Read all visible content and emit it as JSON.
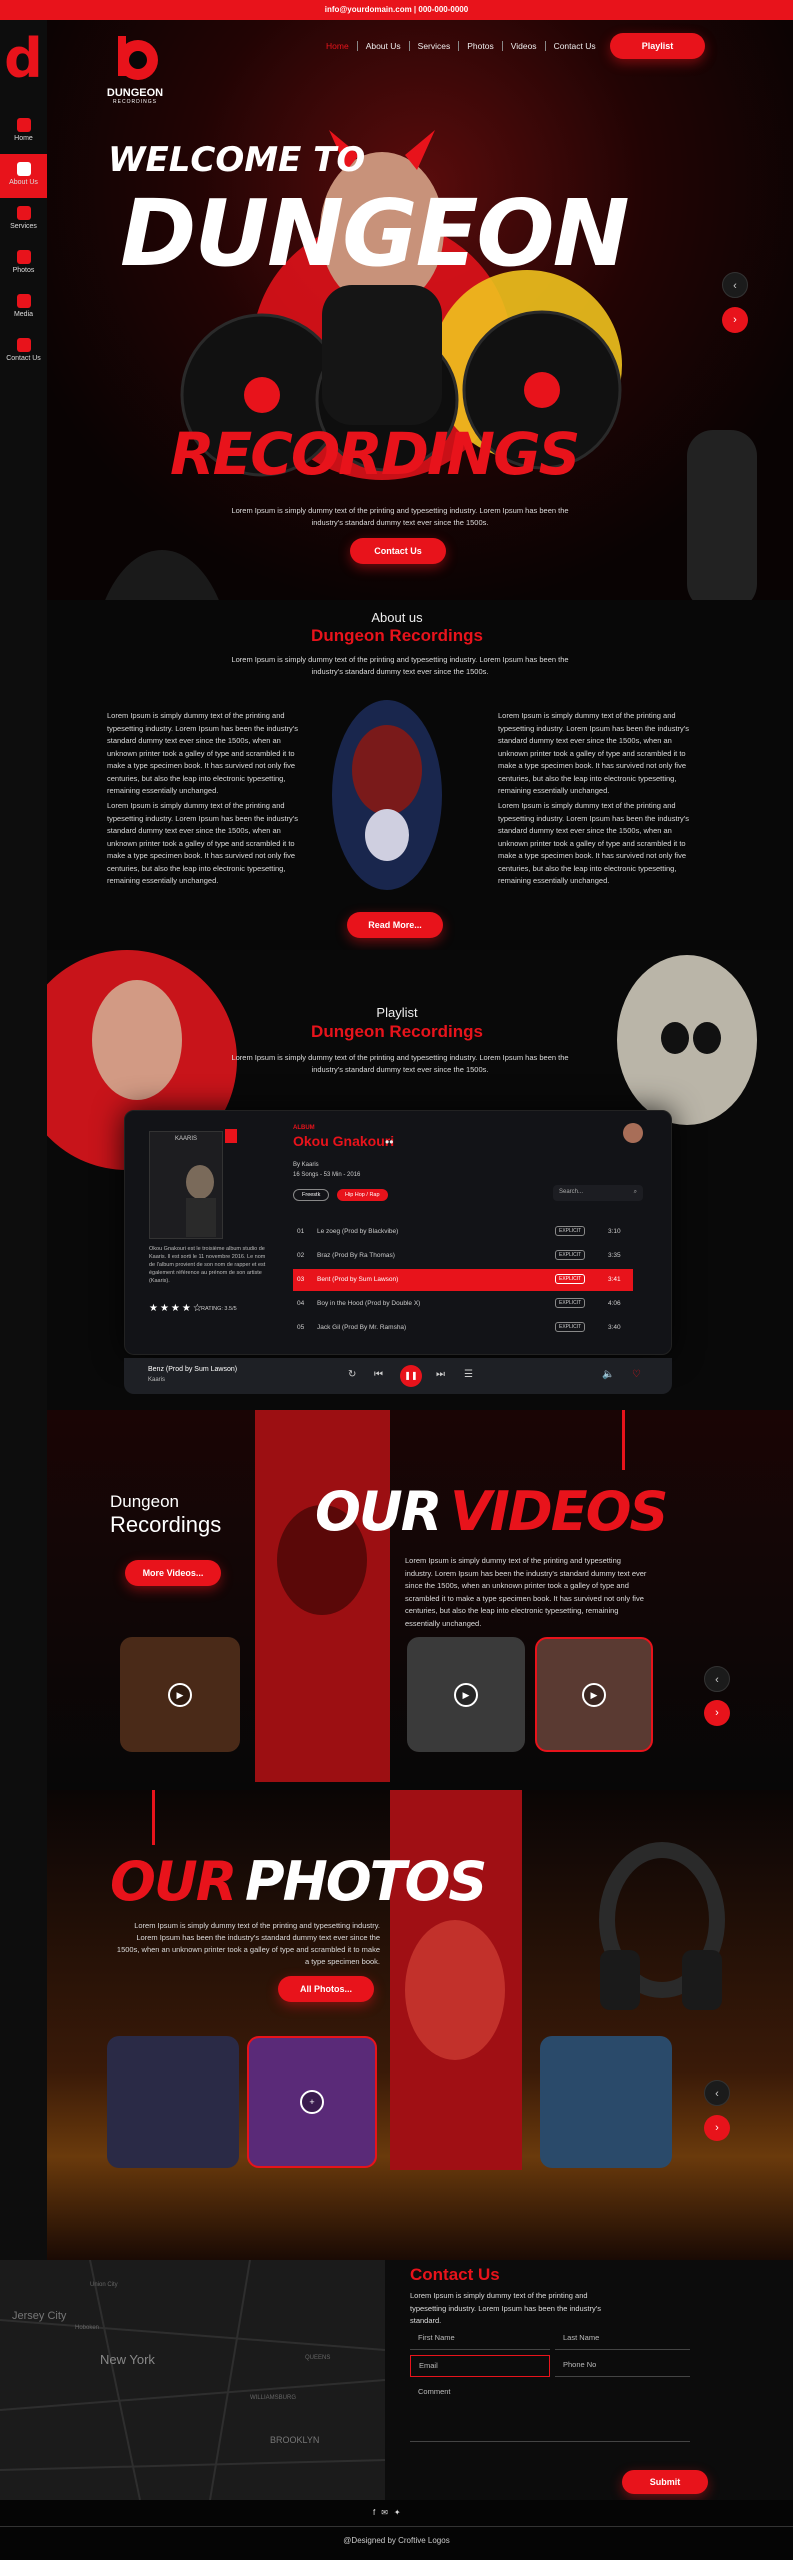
{
  "topbar": {
    "text": "info@yourdomain.com | 000-000-0000"
  },
  "sidebar": {
    "items": [
      {
        "label": "Home",
        "icon": "home-icon"
      },
      {
        "label": "About Us",
        "icon": "about-icon"
      },
      {
        "label": "Services",
        "icon": "services-icon"
      },
      {
        "label": "Photos",
        "icon": "photos-icon"
      },
      {
        "label": "Media",
        "icon": "media-icon"
      },
      {
        "label": "Contact Us",
        "icon": "contact-icon"
      }
    ]
  },
  "brand": {
    "name": "DUNGEON",
    "sub": "RECORDINGS",
    "accent": "#e8131b"
  },
  "nav": {
    "items": [
      "Home",
      "About Us",
      "Services",
      "Photos",
      "Videos",
      "Contact Us"
    ],
    "cta": "Playlist"
  },
  "hero": {
    "welcome": "WELCOME TO",
    "title1": "DUNGEON",
    "title2": "RECORDINGS",
    "text": "Lorem Ipsum is simply dummy text of the printing and typesetting industry. Lorem Ipsum has been the industry's standard dummy text ever since the 1500s.",
    "cta": "Contact Us"
  },
  "about": {
    "sub": "About us",
    "title": "Dungeon Recordings",
    "intro": "Lorem Ipsum is simply dummy text of the printing and typesetting industry. Lorem Ipsum has been the industry's standard dummy text ever since the 1500s.",
    "col_left_1": "Lorem Ipsum is simply dummy text of the printing and typesetting industry. Lorem Ipsum has been the industry's standard dummy text ever since the 1500s, when an unknown printer took a galley of type and scrambled it to make a type specimen book. It has survived not only five centuries, but also the leap into electronic typesetting, remaining essentially unchanged.",
    "col_left_2": "Lorem Ipsum is simply dummy text of the printing and typesetting industry. Lorem Ipsum has been the industry's standard dummy text ever since the 1500s, when an unknown printer took a galley of type and scrambled it to make a type specimen book. It has survived not only five centuries, but also the leap into electronic typesetting, remaining essentially unchanged.",
    "col_right_1": "Lorem Ipsum is simply dummy text of the printing and typesetting industry. Lorem Ipsum has been the industry's standard dummy text ever since the 1500s, when an unknown printer took a galley of type and scrambled it to make a type specimen book. It has survived not only five centuries, but also the leap into electronic typesetting, remaining essentially unchanged.",
    "col_right_2": "Lorem Ipsum is simply dummy text of the printing and typesetting industry. Lorem Ipsum has been the industry's standard dummy text ever since the 1500s, when an unknown printer took a galley of type and scrambled it to make a type specimen book. It has survived not only five centuries, but also the leap into electronic typesetting, remaining essentially unchanged.",
    "cta": "Read More..."
  },
  "playlist": {
    "sub": "Playlist",
    "title": "Dungeon Recordings",
    "intro": "Lorem Ipsum is simply dummy text of the printing and typesetting industry. Lorem Ipsum has been the industry's standard dummy text ever since the 1500s.",
    "album_label": "KAARIS",
    "kind": "ALBUM",
    "artist": "Okou Gnakouri",
    "by": "By Kaaris",
    "meta": "16 Songs - 53 Min - 2016",
    "tags": [
      "Freestk",
      "Hip Hop / Rap"
    ],
    "desc": "Okou Gnakouri est le troisième album studio de Kaaris. Il est sorti le 11 novembre 2016. Le nom de l'album provient de son nom de rapper et est également référence au prénom de son artiste (Kaaris).",
    "rating_label": "RATING: 3.5/5",
    "search_placeholder": "Search...",
    "tracks": [
      {
        "n": "01",
        "title": "Le zoeg (Prod by Blackvibe)",
        "tag": "EXPLICIT",
        "time": "3:10"
      },
      {
        "n": "02",
        "title": "Braz (Prod By Ra Thomas)",
        "tag": "EXPLICIT",
        "time": "3:35"
      },
      {
        "n": "03",
        "title": "Bent (Prod by Sum Lawson)",
        "tag": "EXPLICIT",
        "time": "3:41"
      },
      {
        "n": "04",
        "title": "Boy in the Hood (Prod by Double X)",
        "tag": "EXPLICIT",
        "time": "4:06"
      },
      {
        "n": "05",
        "title": "Jack Gil (Prod By Mr. Ramsha)",
        "tag": "EXPLICIT",
        "time": "3:40"
      }
    ],
    "now_playing": "Benz (Prod by Sum Lawson)",
    "now_artist": "Kaaris"
  },
  "videos": {
    "small": "Dungeon",
    "big": "Recordings",
    "title1": "OUR",
    "title2": "VIDEOS",
    "text": "Lorem Ipsum is simply dummy text of the printing and typesetting industry. Lorem Ipsum has been the industry's standard dummy text ever since the 1500s, when an unknown printer took a galley of type and scrambled it to make a type specimen book. It has survived not only five centuries, but also the leap into electronic typesetting, remaining essentially unchanged.",
    "cta": "More Videos..."
  },
  "photos": {
    "title1": "OUR",
    "title2": "PHOTOS",
    "text": "Lorem Ipsum is simply dummy text of the printing and typesetting industry. Lorem Ipsum has been the industry's standard dummy text ever since the 1500s, when an unknown printer took a galley of type and scrambled it to make a type specimen book.",
    "cta": "All Photos..."
  },
  "map": {
    "labels": [
      "Jersey City",
      "New York",
      "BROOKLYN",
      "WILLIAMSBURG",
      "QUEENS",
      "Union City",
      "Hoboken"
    ]
  },
  "contact": {
    "title": "Contact Us",
    "text": "Lorem Ipsum is simply dummy text of the printing and typesetting industry. Lorem Ipsum has been the industry's standard.",
    "first": "First Name",
    "last": "Last Name",
    "email": "Email",
    "phone": "Phone No",
    "comment": "Comment",
    "submit": "Submit"
  },
  "footer": {
    "credit": "@Designed by Croftive Logos"
  }
}
